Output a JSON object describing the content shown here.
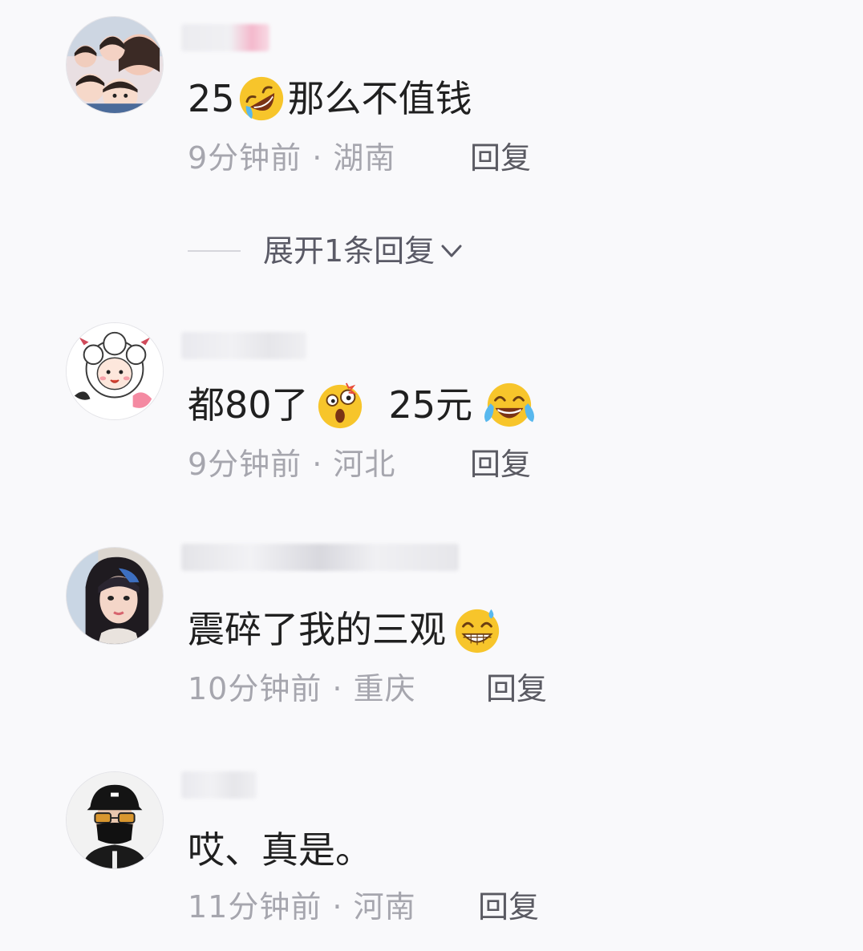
{
  "comments": [
    {
      "text_prefix": "25",
      "text_emoji": "rolling-on-floor-laughing-emoji",
      "text_suffix": "那么不值钱",
      "meta": "9分钟前 · 湖南",
      "reply_label": "回复"
    },
    {
      "text_prefix": "都80了",
      "text_emoji": "astonished-face-emoji",
      "text_mid": "25元",
      "text_emoji2": "tears-of-joy-emoji",
      "meta": "9分钟前 · 河北",
      "reply_label": "回复"
    },
    {
      "text_prefix": "震碎了我的三观",
      "text_emoji": "grinning-sweat-emoji",
      "meta": "10分钟前 · 重庆",
      "reply_label": "回复"
    },
    {
      "text_prefix": "哎、真是。",
      "meta": "11分钟前 · 河南",
      "reply_label": "回复"
    }
  ],
  "expand_replies": {
    "label": "展开1条回复",
    "icon": "chevron-down-icon"
  },
  "colors": {
    "background": "#f9f9fb",
    "text": "#202020",
    "meta": "#a6a6ae",
    "reply": "#5a5a62",
    "emoji_yellow": "#f7c52b"
  }
}
